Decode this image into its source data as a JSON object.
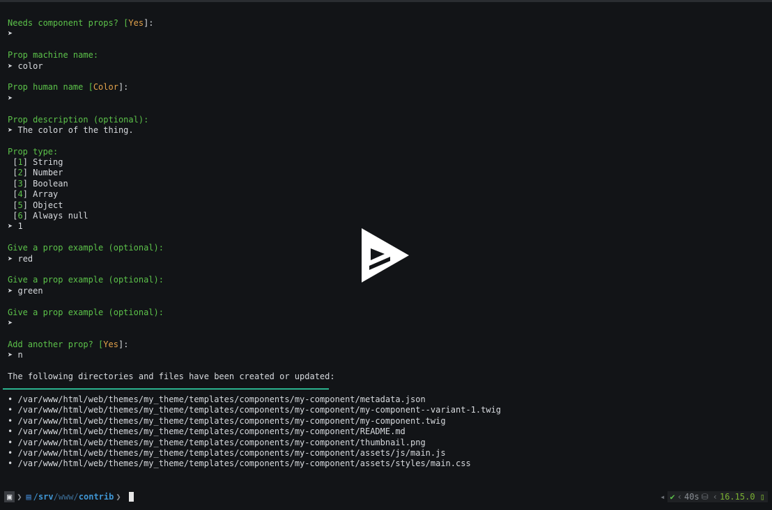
{
  "session": [
    {
      "prompt": [
        "Needs component props? [",
        "Yes",
        "]:"
      ],
      "answer": ""
    },
    {
      "prompt": [
        "Prop machine name:"
      ],
      "answer": "color"
    },
    {
      "prompt": [
        "Prop human name [",
        "Color",
        "]:"
      ],
      "answer": ""
    },
    {
      "prompt": [
        "Prop description (optional):"
      ],
      "answer": "The color of the thing."
    },
    {
      "prompt": [
        "Prop type:"
      ],
      "answer": "1"
    },
    {
      "prompt": [
        "Give a prop example (optional):"
      ],
      "answer": "red"
    },
    {
      "prompt": [
        "Give a prop example (optional):"
      ],
      "answer": "green"
    },
    {
      "prompt": [
        "Give a prop example (optional):"
      ],
      "answer": ""
    },
    {
      "prompt": [
        "Add another prop? [",
        "Yes",
        "]:"
      ],
      "answer": "n"
    }
  ],
  "prop_type_options": [
    {
      "num": "1",
      "label": "String"
    },
    {
      "num": "2",
      "label": "Number"
    },
    {
      "num": "3",
      "label": "Boolean"
    },
    {
      "num": "4",
      "label": "Array"
    },
    {
      "num": "5",
      "label": "Object"
    },
    {
      "num": "6",
      "label": "Always null"
    }
  ],
  "arrow_symbol": "➤",
  "summary_heading": "The following directories and files have been created or updated:",
  "bullet": "•",
  "files": [
    "/var/www/html/web/themes/my_theme/templates/components/my-component/metadata.json",
    "/var/www/html/web/themes/my_theme/templates/components/my-component/my-component--variant-1.twig",
    "/var/www/html/web/themes/my_theme/templates/components/my-component/my-component.twig",
    "/var/www/html/web/themes/my_theme/templates/components/my-component/README.md",
    "/var/www/html/web/themes/my_theme/templates/components/my-component/thumbnail.png",
    "/var/www/html/web/themes/my_theme/templates/components/my-component/assets/js/main.js",
    "/var/www/html/web/themes/my_theme/templates/components/my-component/assets/styles/main.css"
  ],
  "shell_prompt": {
    "path_root": "/",
    "path_srv": "srv",
    "path_slash1": "/",
    "path_www": "www",
    "path_slash2": "/",
    "path_contrib": "contrib"
  },
  "status_bar": {
    "check": "✔",
    "duration": "40s",
    "node_version": "16.15.0"
  },
  "colors": {
    "background": "#121417",
    "prompt_green": "#5cc24a",
    "default_orange": "#e2a24b",
    "separator_teal": "#2bb38f",
    "path_blue": "#3f96d4"
  },
  "icons": [
    "terminal-icon",
    "folder-icon",
    "play-icon",
    "disk-icon"
  ]
}
